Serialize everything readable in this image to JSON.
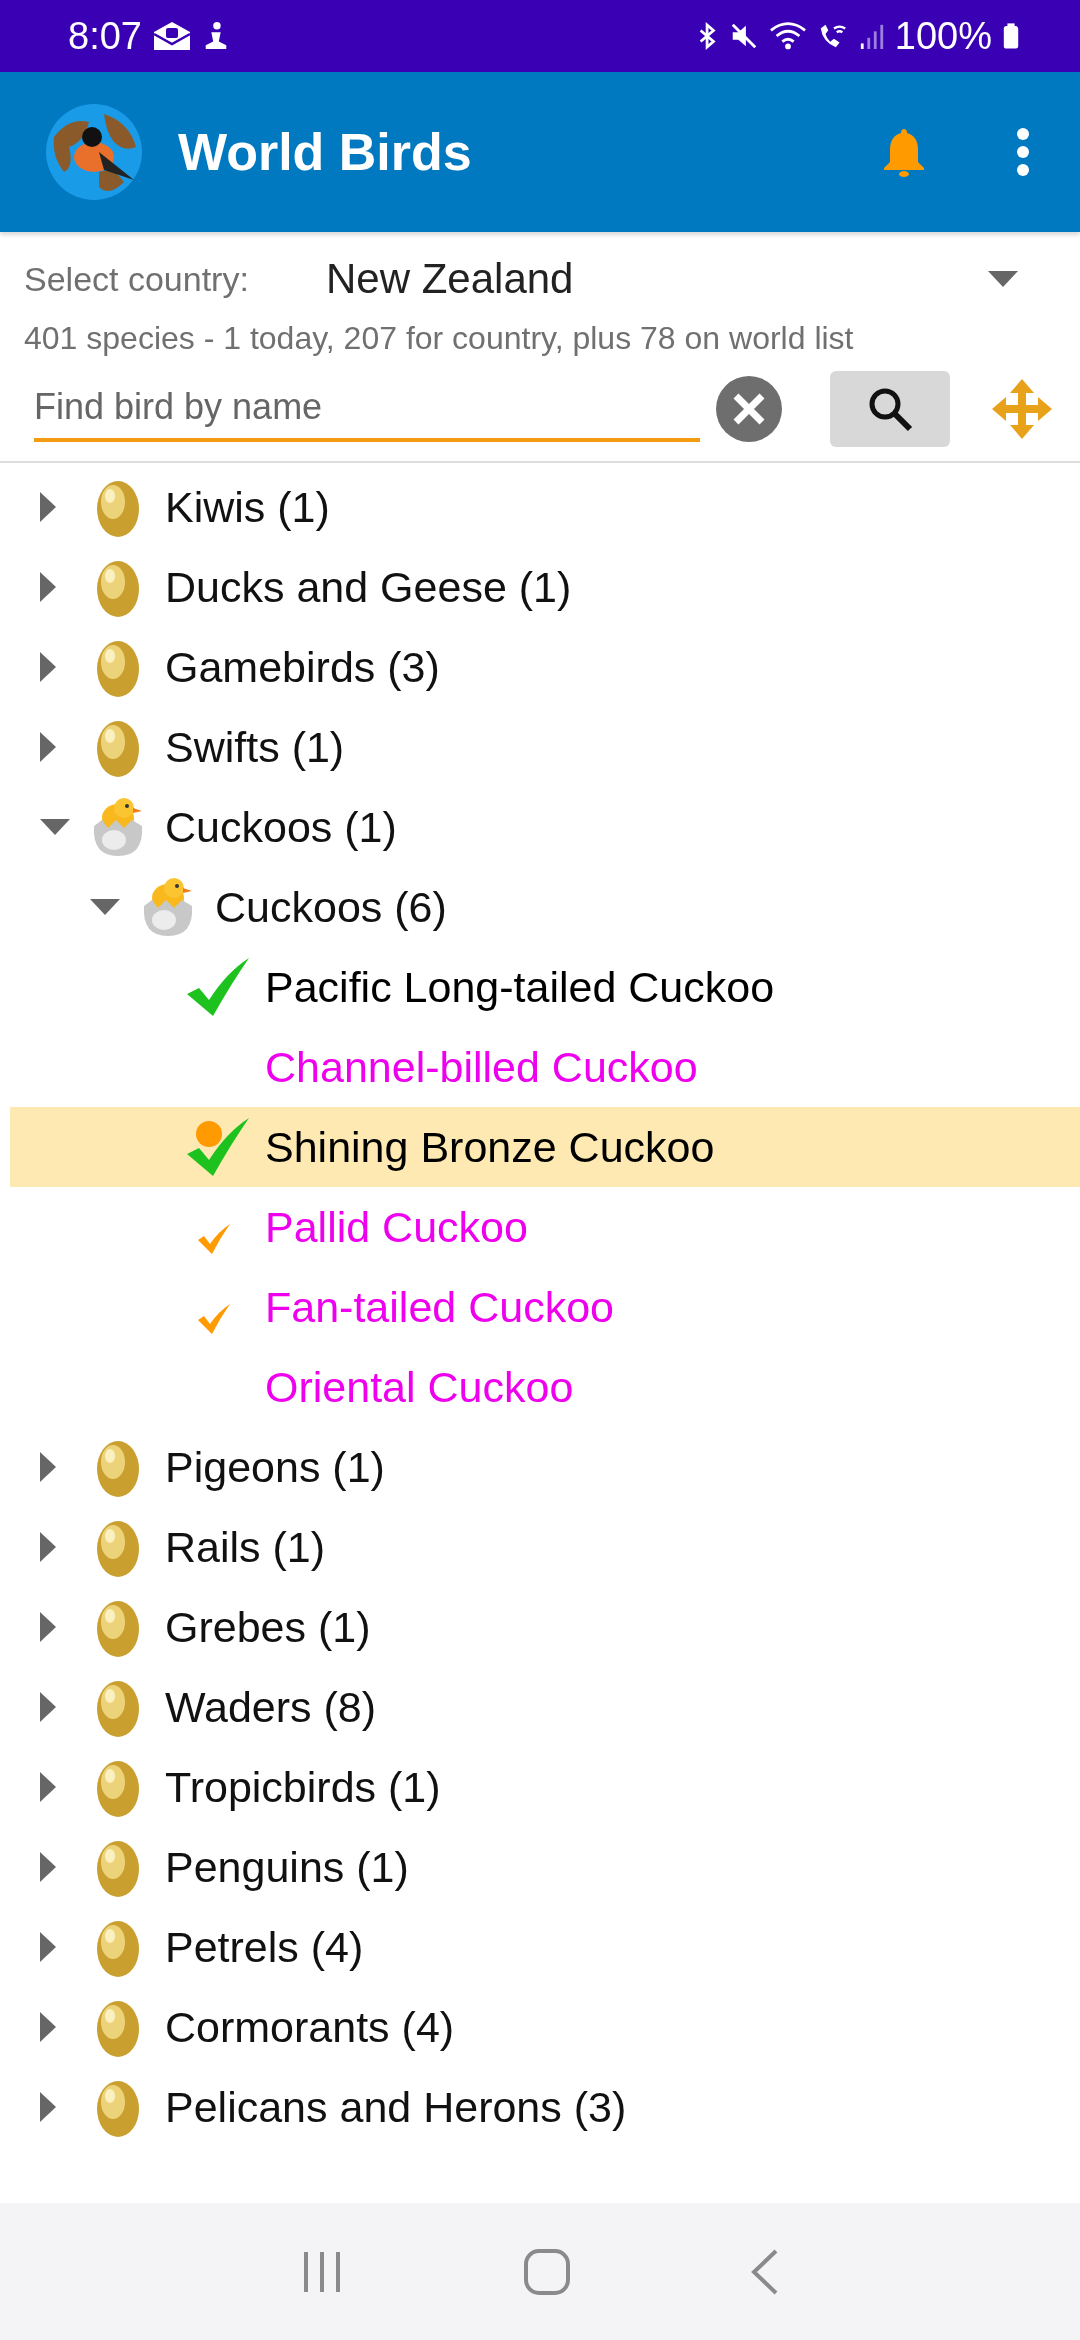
{
  "status_bar": {
    "time": "8:07",
    "battery": "100%"
  },
  "app_bar": {
    "title": "World Birds"
  },
  "country": {
    "label": "Select country:",
    "value": "New Zealand"
  },
  "summary": "401 species - 1 today, 207 for country, plus 78 on world list",
  "search": {
    "placeholder": "Find bird by name"
  },
  "tree": [
    {
      "kind": "group",
      "label": "Kiwis (1)",
      "expanded": false
    },
    {
      "kind": "group",
      "label": "Ducks and Geese (1)",
      "expanded": false
    },
    {
      "kind": "group",
      "label": "Gamebirds (3)",
      "expanded": false
    },
    {
      "kind": "group",
      "label": "Swifts (1)",
      "expanded": false
    },
    {
      "kind": "group",
      "label": "Cuckoos (1)",
      "expanded": true,
      "children": [
        {
          "kind": "group",
          "label": "Cuckoos (6)",
          "expanded": true,
          "children": [
            {
              "kind": "seen",
              "label": "Pacific Long-tailed Cuckoo",
              "color": "#000000",
              "selected": false
            },
            {
              "kind": "unseen",
              "label": "Channel-billed Cuckoo",
              "color": "#ee00ee",
              "selected": false
            },
            {
              "kind": "seen-today",
              "label": "Shining Bronze Cuckoo",
              "color": "#000000",
              "selected": true
            },
            {
              "kind": "world",
              "label": "Pallid Cuckoo",
              "color": "#ee00ee",
              "selected": false
            },
            {
              "kind": "world",
              "label": "Fan-tailed Cuckoo",
              "color": "#ee00ee",
              "selected": false
            },
            {
              "kind": "unseen",
              "label": "Oriental Cuckoo",
              "color": "#ee00ee",
              "selected": false
            }
          ]
        }
      ]
    },
    {
      "kind": "group",
      "label": "Pigeons (1)",
      "expanded": false
    },
    {
      "kind": "group",
      "label": "Rails (1)",
      "expanded": false
    },
    {
      "kind": "group",
      "label": "Grebes (1)",
      "expanded": false
    },
    {
      "kind": "group",
      "label": "Waders (8)",
      "expanded": false
    },
    {
      "kind": "group",
      "label": "Tropicbirds (1)",
      "expanded": false
    },
    {
      "kind": "group",
      "label": "Penguins (1)",
      "expanded": false
    },
    {
      "kind": "group",
      "label": "Petrels (4)",
      "expanded": false
    },
    {
      "kind": "group",
      "label": "Cormorants (4)",
      "expanded": false
    },
    {
      "kind": "group",
      "label": "Pelicans and Herons (3)",
      "expanded": false
    }
  ]
}
